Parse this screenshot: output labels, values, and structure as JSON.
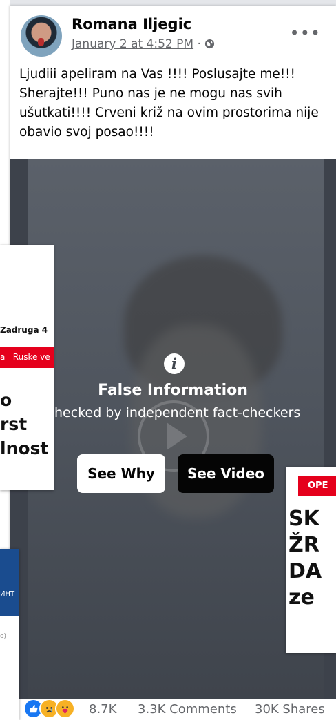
{
  "post": {
    "author": "Romana Iljegic",
    "date": "January 2 at 4:52 PM",
    "separator": "·",
    "more": "•••",
    "text": "Ljudiii apeliram na Vas !!!! Poslusajte me!!! Sherajte!!! Puno nas je ne mogu nas svih ušutkati!!!! Crveni križ na ovim prostorima nije obavio svoj posao!!!!"
  },
  "video": {
    "warning_title": "False Information",
    "warning_sub": "Checked by independent fact-checkers",
    "see_why": "See Why",
    "see_video": "See Video"
  },
  "footer": {
    "reaction_count": "8.7K",
    "comments": "3.3K Comments",
    "shares": "30K Shares"
  },
  "overlay_left": {
    "heading": "Zadruga 4",
    "bar": "a   Ruske ve",
    "line1": "o",
    "line2": "rst",
    "line3": "lnost"
  },
  "overlay_left_bottom": {
    "tag": "ИНТ",
    "small": "o)"
  },
  "overlay_right": {
    "tag": "OPE",
    "line1": "SK",
    "line2": "ŽR",
    "line3": "DA",
    "line4": "ze"
  },
  "colors": {
    "accent": "#1877f2",
    "overlay_red": "#e5001c",
    "overlay_blue": "#1a4c8f"
  }
}
